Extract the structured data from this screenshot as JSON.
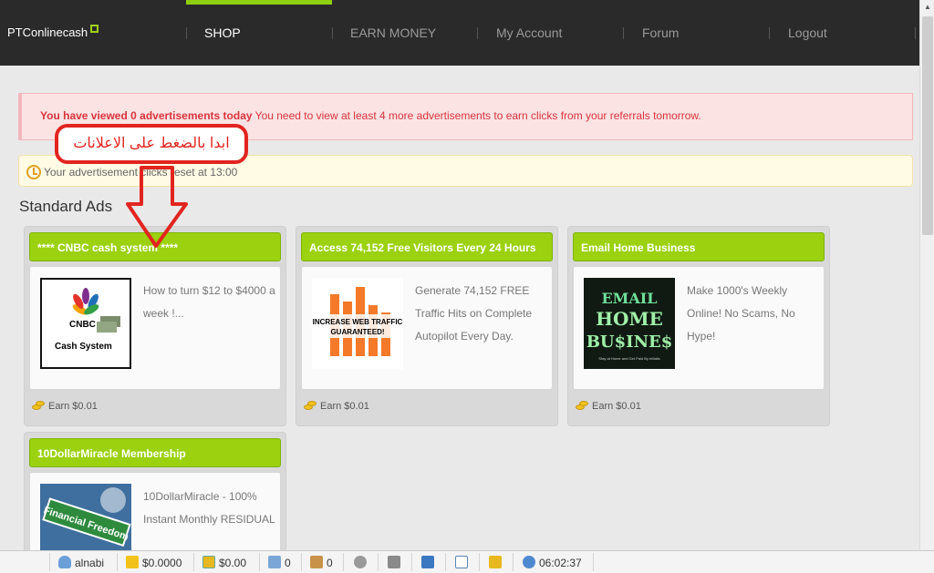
{
  "header": {
    "brand": "PTConlinecash",
    "nav": [
      "SHOP",
      "EARN MONEY",
      "My Account",
      "Forum",
      "Logout"
    ]
  },
  "alerts": {
    "error_bold": "You have viewed 0 advertisements today",
    "error_rest": " You need to view at least 4 more advertisements to earn clicks from your referrals tomorrow.",
    "info": "Your advertisement clicks reset at 13:00"
  },
  "annotation": {
    "text": "ابدا بالضغط على الاعلانات"
  },
  "section_title": "Standard Ads",
  "ads": [
    {
      "title": "**** CNBC cash system ****",
      "description": "How to turn $12 to $4000 a week !...",
      "earn": "Earn $0.01",
      "image_text_1": "CNBC",
      "image_text_2": "Cash System"
    },
    {
      "title": "Access 74,152 Free Visitors Every 24 Hours",
      "description": "Generate 74,152 FREE Traffic Hits on Complete Autopilot Every Day.",
      "earn": "Earn $0.01",
      "image_text_1": "INCREASE WEB TRAFFIC",
      "image_text_2": "GUARANTEED!"
    },
    {
      "title": "Email Home Business",
      "description": "Make 1000's Weekly Online! No Scams, No Hype!",
      "earn": "Earn $0.01",
      "image_text_1": "EMAIL",
      "image_text_2": "HOME",
      "image_text_3": "BU$INE$",
      "image_text_4": "Stay at Home and Get Paid By eMails"
    },
    {
      "title": "10DollarMiracle Membership",
      "description": "10DollarMiracle - 100% Instant Monthly RESIDUAL",
      "earn": "",
      "image_text_1": "Financial Freedom"
    }
  ],
  "statusbar": {
    "username": "alnabi",
    "balance": "$0.0000",
    "purchase_balance": "$0.00",
    "referrals": "0",
    "rented_referrals": "0",
    "clock": "06:02:37"
  },
  "colors": {
    "accent_green": "#9bd10e",
    "topbar": "#2a2a2a",
    "error_text": "#d9333d",
    "annotation_red": "#e2241f"
  }
}
